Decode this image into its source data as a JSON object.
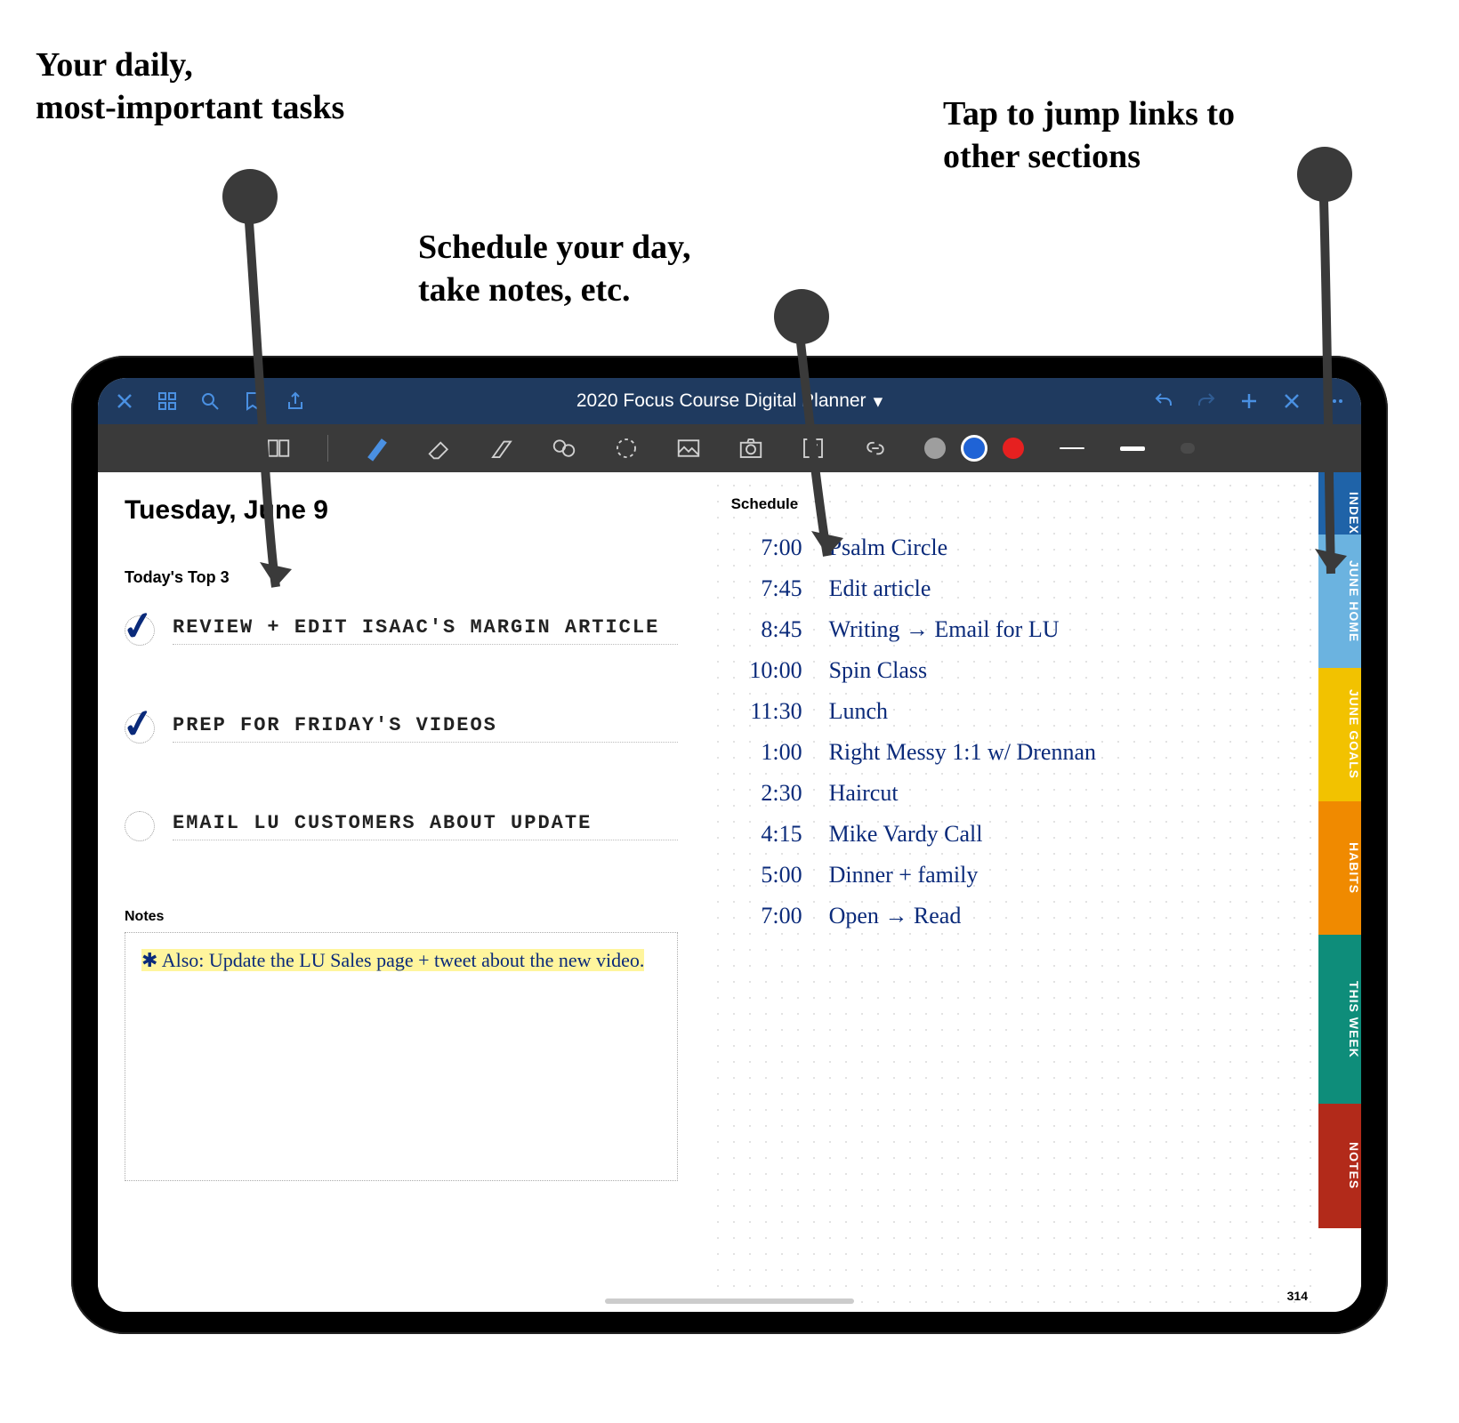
{
  "annotations": {
    "tasks_callout": "Your daily,\nmost-important tasks",
    "schedule_callout": "Schedule your day,\ntake notes, etc.",
    "tabs_callout": "Tap to jump links to\nother sections"
  },
  "app": {
    "title": "2020 Focus Course Digital Planner",
    "chevron": "▾"
  },
  "planner": {
    "date_heading": "Tuesday, June 9",
    "top3_label": "Today's Top 3",
    "tasks": [
      {
        "text": "Review + edit Isaac's Margin Article",
        "checked": true
      },
      {
        "text": "Prep for Friday's videos",
        "checked": true
      },
      {
        "text": "Email LU customers about update",
        "checked": false
      }
    ],
    "notes_label": "Notes",
    "notes_text": "✱ Also: Update the LU Sales page + tweet about the new video.",
    "schedule_label": "Schedule",
    "schedule": [
      {
        "time": "7:00",
        "item": "Psalm Circle"
      },
      {
        "time": "7:45",
        "item": "Edit article"
      },
      {
        "time": "8:45",
        "item": "Writing → Email for LU"
      },
      {
        "time": "10:00",
        "item": "Spin Class"
      },
      {
        "time": "11:30",
        "item": "Lunch"
      },
      {
        "time": "1:00",
        "item": "Right Messy 1:1 w/ Drennan"
      },
      {
        "time": "2:30",
        "item": "Haircut"
      },
      {
        "time": "4:15",
        "item": "Mike Vardy Call"
      },
      {
        "time": "5:00",
        "item": "Dinner + family"
      },
      {
        "time": "7:00",
        "item": "Open → Read"
      }
    ],
    "tabs": [
      {
        "label": "INDEX",
        "color": "#1f63a8"
      },
      {
        "label": "JUNE HOME",
        "color": "#6bb3e0"
      },
      {
        "label": "JUNE GOALS",
        "color": "#f2c200"
      },
      {
        "label": "HABITS",
        "color": "#f08a00"
      },
      {
        "label": "THIS WEEK",
        "color": "#0e8d7a"
      },
      {
        "label": "NOTES",
        "color": "#b22a1a"
      }
    ],
    "page_number": "314"
  },
  "swatches": {
    "gray": "#9e9e9e",
    "blue": "#1f63d6",
    "red": "#e62020"
  }
}
